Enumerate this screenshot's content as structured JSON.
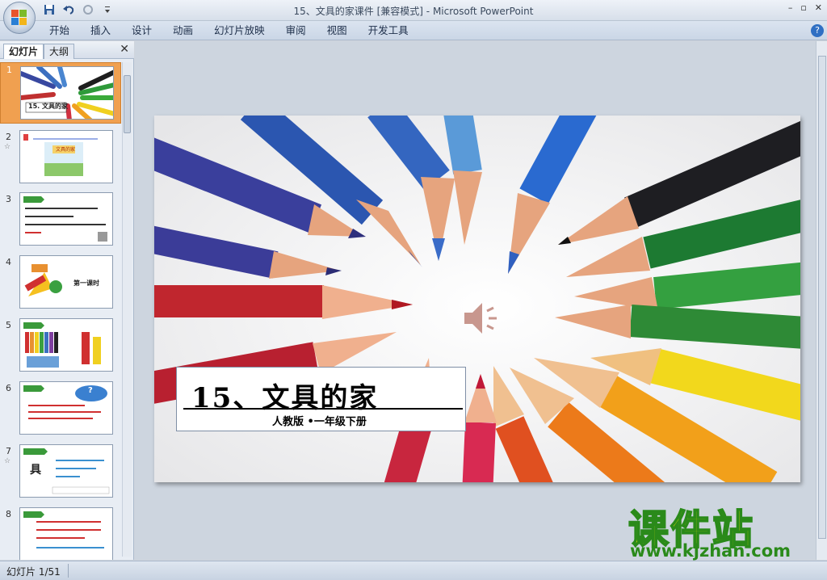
{
  "window": {
    "title": "15、文具的家课件 [兼容模式] - Microsoft PowerPoint",
    "minimize": "–",
    "restore": "▫",
    "close": "✕"
  },
  "quick_access": [
    "save-icon",
    "undo-icon",
    "redo-icon",
    "customize-icon"
  ],
  "ribbon": {
    "tabs": [
      "开始",
      "插入",
      "设计",
      "动画",
      "幻灯片放映",
      "审阅",
      "视图",
      "开发工具"
    ],
    "help": "?"
  },
  "left_pane": {
    "tab_slides": "幻灯片",
    "tab_outline": "大纲",
    "close": "✕",
    "slides": [
      {
        "num": "1",
        "selected": true,
        "caption": "15. 文具的家"
      },
      {
        "num": "2",
        "star": "☆",
        "caption": "文具的家"
      },
      {
        "num": "3",
        "caption": ""
      },
      {
        "num": "4",
        "caption": "第一课时"
      },
      {
        "num": "5",
        "caption": ""
      },
      {
        "num": "6",
        "caption": "?"
      },
      {
        "num": "7",
        "star": "☆",
        "caption": "具"
      },
      {
        "num": "8",
        "caption": ""
      }
    ]
  },
  "slide": {
    "title": "15、文具的家",
    "subtitle": "人教版 •一年级下册"
  },
  "status": {
    "slide_info": "幻灯片 1/51"
  },
  "watermark": {
    "text": "课件站",
    "url": "www.kjzhan.com"
  },
  "colors": {
    "accent_orange": "#f0a050",
    "watermark_yellow": "#f5e600",
    "watermark_green": "#2a8a1a"
  }
}
